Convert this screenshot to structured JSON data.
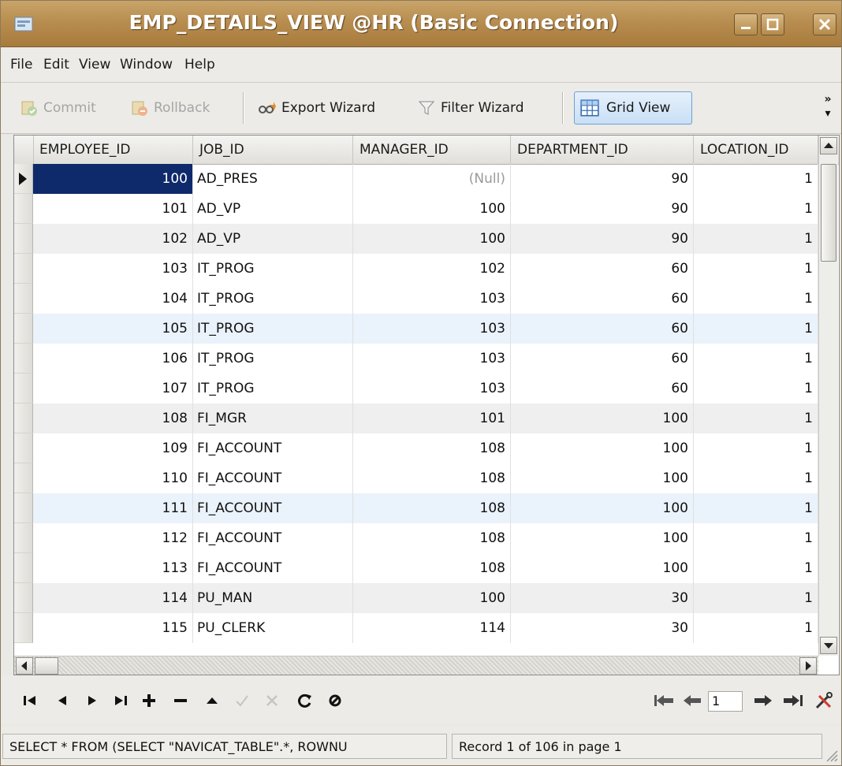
{
  "window": {
    "title": "EMP_DETAILS_VIEW @HR (Basic Connection)"
  },
  "menu": [
    "File",
    "Edit",
    "View",
    "Window",
    "Help"
  ],
  "toolbar": {
    "commit": "Commit",
    "rollback": "Rollback",
    "export_wizard": "Export Wizard",
    "filter_wizard": "Filter Wizard",
    "grid_view": "Grid View",
    "overflow": "»"
  },
  "grid": {
    "columns": [
      "EMPLOYEE_ID",
      "JOB_ID",
      "MANAGER_ID",
      "DEPARTMENT_ID",
      "LOCATION_ID"
    ],
    "rows": [
      {
        "employee_id": "100",
        "job_id": "AD_PRES",
        "manager_id": "(Null)",
        "department_id": "90",
        "location_id": "1"
      },
      {
        "employee_id": "101",
        "job_id": "AD_VP",
        "manager_id": "100",
        "department_id": "90",
        "location_id": "1"
      },
      {
        "employee_id": "102",
        "job_id": "AD_VP",
        "manager_id": "100",
        "department_id": "90",
        "location_id": "1"
      },
      {
        "employee_id": "103",
        "job_id": "IT_PROG",
        "manager_id": "102",
        "department_id": "60",
        "location_id": "1"
      },
      {
        "employee_id": "104",
        "job_id": "IT_PROG",
        "manager_id": "103",
        "department_id": "60",
        "location_id": "1"
      },
      {
        "employee_id": "105",
        "job_id": "IT_PROG",
        "manager_id": "103",
        "department_id": "60",
        "location_id": "1"
      },
      {
        "employee_id": "106",
        "job_id": "IT_PROG",
        "manager_id": "103",
        "department_id": "60",
        "location_id": "1"
      },
      {
        "employee_id": "107",
        "job_id": "IT_PROG",
        "manager_id": "103",
        "department_id": "60",
        "location_id": "1"
      },
      {
        "employee_id": "108",
        "job_id": "FI_MGR",
        "manager_id": "101",
        "department_id": "100",
        "location_id": "1"
      },
      {
        "employee_id": "109",
        "job_id": "FI_ACCOUNT",
        "manager_id": "108",
        "department_id": "100",
        "location_id": "1"
      },
      {
        "employee_id": "110",
        "job_id": "FI_ACCOUNT",
        "manager_id": "108",
        "department_id": "100",
        "location_id": "1"
      },
      {
        "employee_id": "111",
        "job_id": "FI_ACCOUNT",
        "manager_id": "108",
        "department_id": "100",
        "location_id": "1"
      },
      {
        "employee_id": "112",
        "job_id": "FI_ACCOUNT",
        "manager_id": "108",
        "department_id": "100",
        "location_id": "1"
      },
      {
        "employee_id": "113",
        "job_id": "FI_ACCOUNT",
        "manager_id": "108",
        "department_id": "100",
        "location_id": "1"
      },
      {
        "employee_id": "114",
        "job_id": "PU_MAN",
        "manager_id": "100",
        "department_id": "30",
        "location_id": "1"
      },
      {
        "employee_id": "115",
        "job_id": "PU_CLERK",
        "manager_id": "114",
        "department_id": "30",
        "location_id": "1"
      }
    ]
  },
  "navigation": {
    "page_value": "1"
  },
  "status": {
    "sql": "SELECT * FROM (SELECT \"NAVICAT_TABLE\".*, ROWNU",
    "record_info": "Record 1 of 106 in page 1"
  },
  "colors": {
    "selected_cell": "#0f2a6b",
    "title_bar": "#b88d50",
    "grid_view_active": "#c9dff6"
  }
}
